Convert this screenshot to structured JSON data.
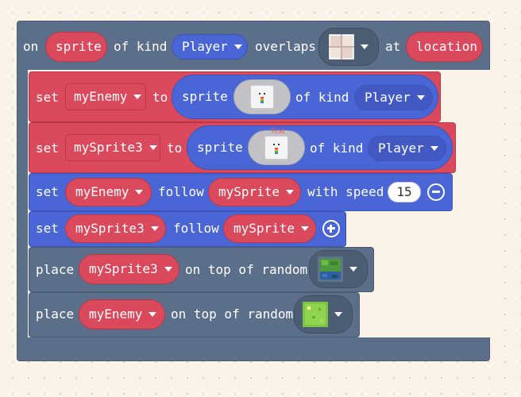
{
  "colors": {
    "event_block": "#5c6f8a",
    "sprite_block": "#db4a5c",
    "movement_block": "#4a66d6",
    "scene_block": "#5c6f8a",
    "canvas_bg": "#fbf3e7"
  },
  "event": {
    "on": "on",
    "sprite_param": "sprite",
    "of_kind": "of kind",
    "kind": "Player",
    "overlaps": "overlaps",
    "tile_icon": "tile-grid-icon",
    "at": "at",
    "location_param": "location"
  },
  "statements": [
    {
      "set": "set",
      "variable": "myEnemy",
      "to": "to",
      "sprite": "sprite",
      "sprite_icon": "sprite-image-icon",
      "of_kind": "of kind",
      "kind": "Player"
    },
    {
      "set": "set",
      "variable": "mySprite3",
      "to": "to",
      "sprite": "sprite",
      "sprite_icon": "sprite-image-icon",
      "sprite_caption": "Text",
      "of_kind": "of kind",
      "kind": "Player"
    },
    {
      "set": "set",
      "variable": "myEnemy",
      "follow": "follow",
      "target": "mySprite",
      "with_speed": "with speed",
      "speed": "15",
      "button_icon": "minus-circle-icon"
    },
    {
      "set": "set",
      "variable": "mySprite3",
      "follow": "follow",
      "target": "mySprite",
      "button_icon": "plus-circle-icon"
    },
    {
      "place": "place",
      "variable": "mySprite3",
      "on_top_of_random": "on top of random",
      "tile_icon": "grass-tile-icon"
    },
    {
      "place": "place",
      "variable": "myEnemy",
      "on_top_of_random": "on top of random",
      "tile_icon": "grass-tile-icon"
    }
  ]
}
